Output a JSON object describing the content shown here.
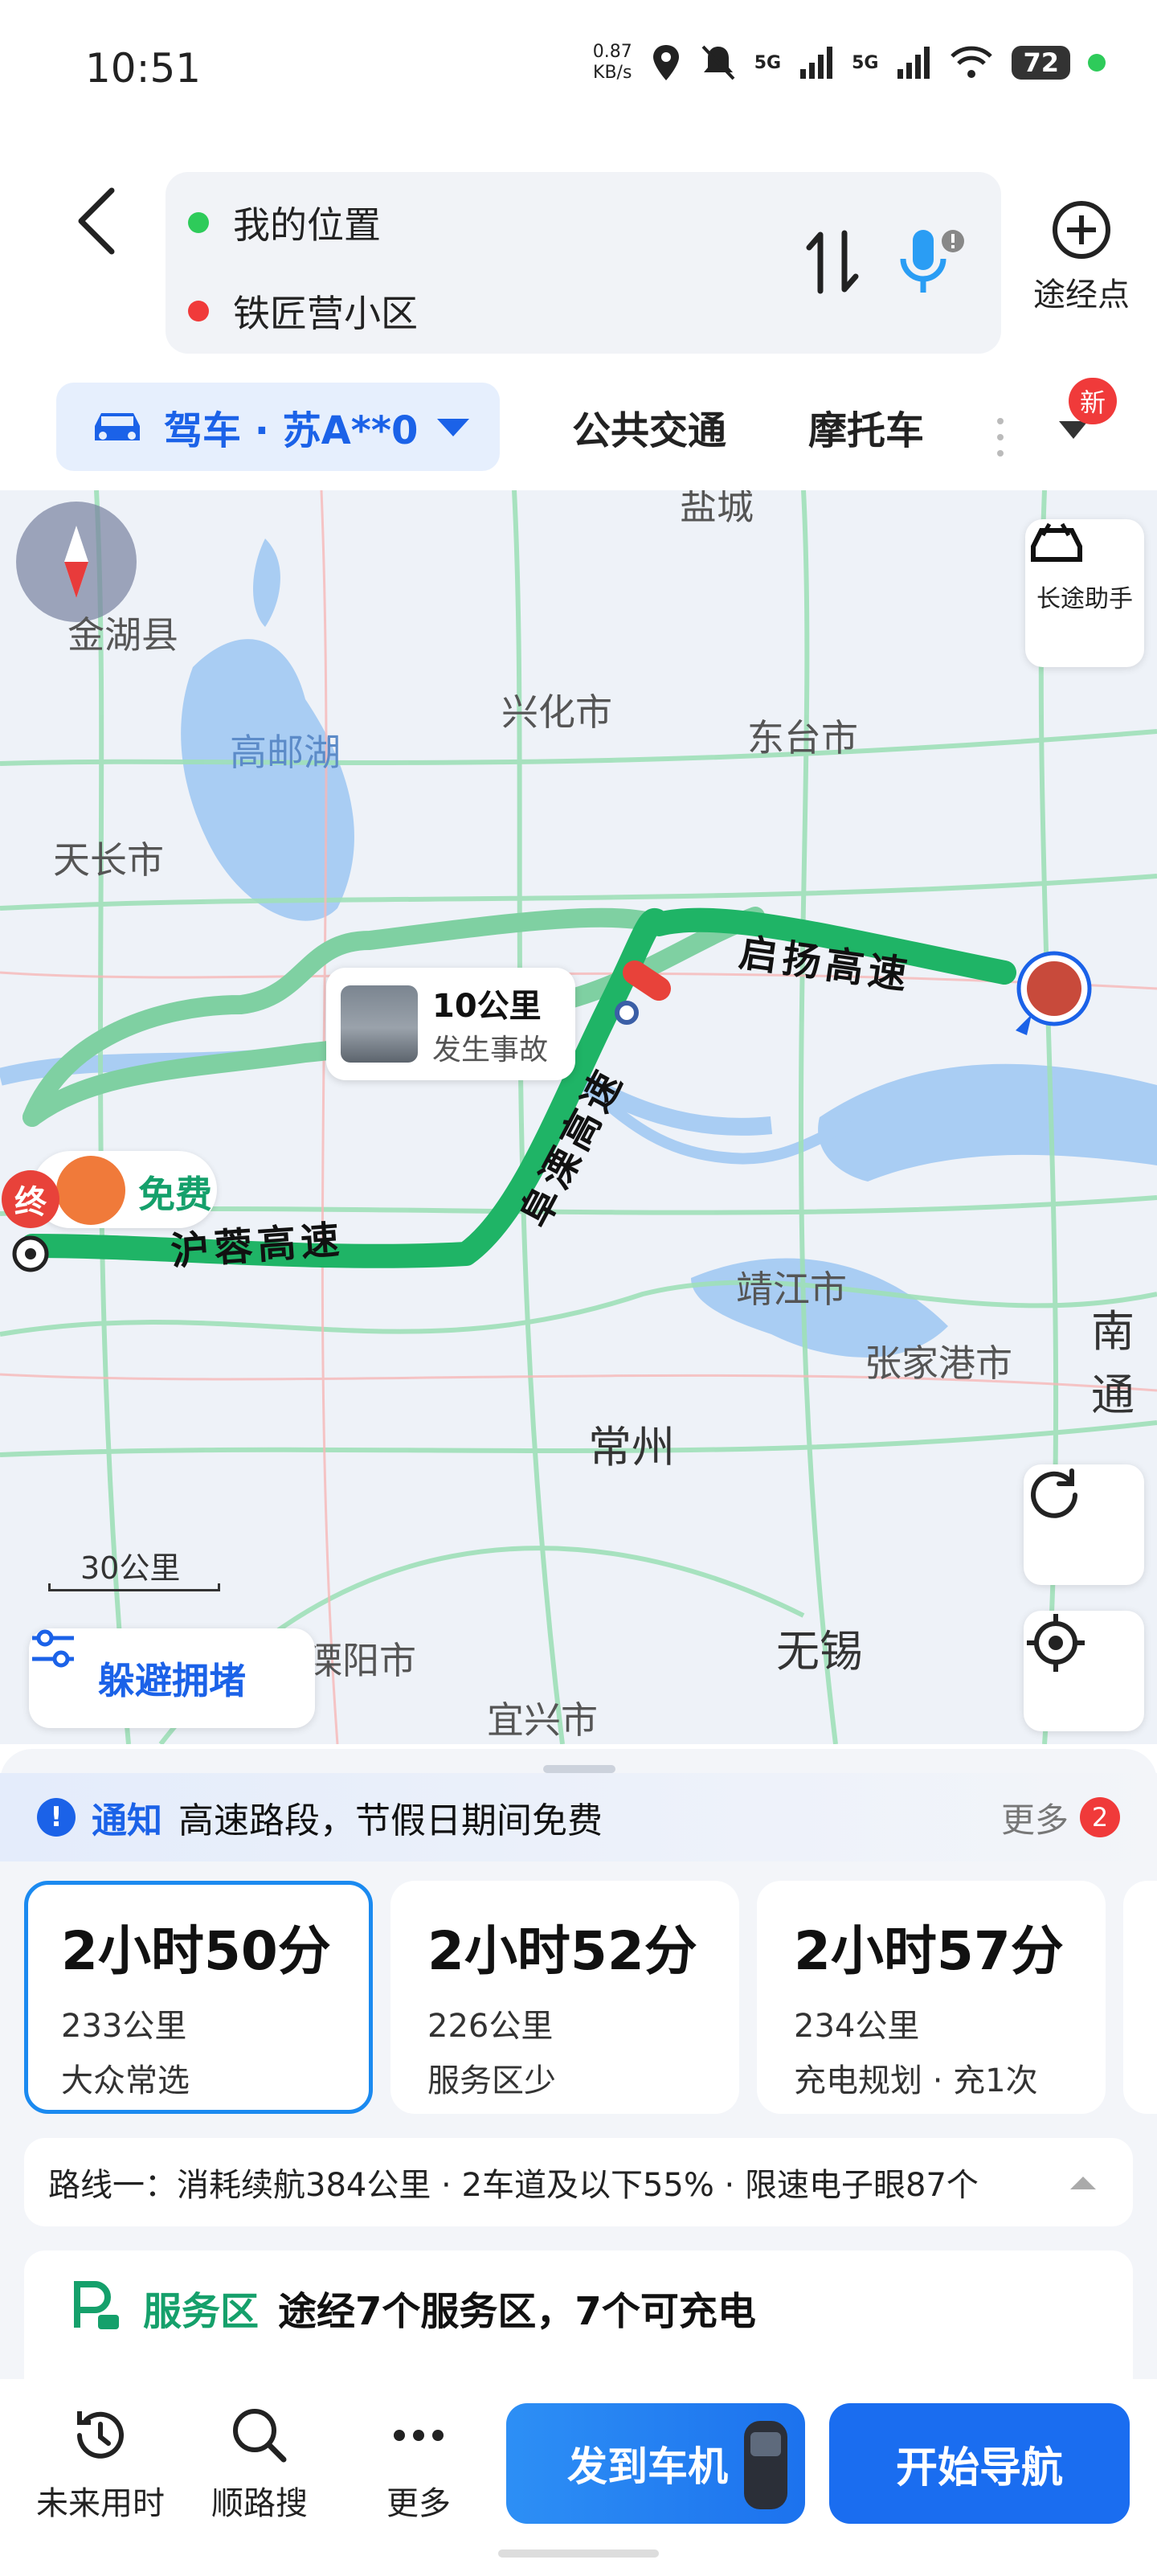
{
  "status": {
    "time": "10:51",
    "net_speed_value": "0.87",
    "net_speed_unit": "KB/s",
    "signal1": "5G",
    "signal2": "5G",
    "wifi_sub": "6",
    "battery": "72"
  },
  "route": {
    "origin": "我的位置",
    "destination": "铁匠营小区",
    "waypoint_label": "途经点"
  },
  "modes": {
    "drive": "驾车 · 苏A**0",
    "transit": "公共交通",
    "moto": "摩托车",
    "new_badge": "新"
  },
  "map": {
    "long_trip_assist": "长途助手",
    "labels": [
      "金湖县",
      "高邮湖",
      "兴化市",
      "东台市",
      "天长市",
      "靖江市",
      "张家港市",
      "常州",
      "无锡",
      "溧阳市",
      "宜兴市",
      "南通",
      "盐城"
    ],
    "highways": [
      "启扬高速",
      "阜溧高速",
      "沪蓉高速"
    ],
    "accident_distance": "10公里",
    "accident_desc": "发生事故",
    "free_tag": "免费",
    "end_marker": "终",
    "scale": "30公里",
    "avoid_congestion": "躲避拥堵",
    "colors": {
      "route": "#1fb466",
      "route_alt": "#7fd0a2",
      "water": "#a9cdf3",
      "accent": "#1b62e8"
    }
  },
  "notice": {
    "label": "通知",
    "text": "高速路段，节假日期间免费",
    "more": "更多",
    "count": "2"
  },
  "options": [
    {
      "time": "2小时50分",
      "distance": "233公里",
      "tag": "大众常选"
    },
    {
      "time": "2小时52分",
      "distance": "226公里",
      "tag": "服务区少"
    },
    {
      "time": "2小时57分",
      "distance": "234公里",
      "tag": "充电规划 · 充1次"
    }
  ],
  "route_info": "路线一：消耗续航384公里 · 2车道及以下55% · 限速电子眼87个",
  "service": {
    "label": "服务区",
    "text": "途经7个服务区，7个可充电"
  },
  "bottom": {
    "future_time": "未来用时",
    "along_search": "顺路搜",
    "more": "更多",
    "send_to_car": "发到车机",
    "start_nav": "开始导航"
  }
}
